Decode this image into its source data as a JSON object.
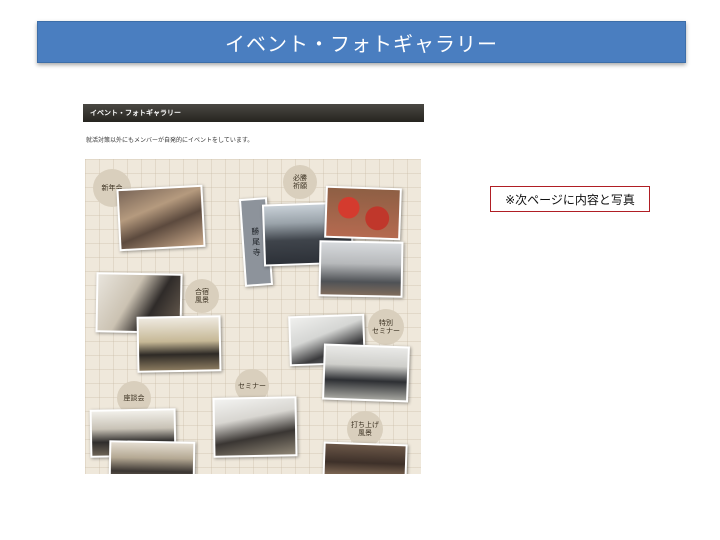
{
  "slide": {
    "title": "イベント・フォトギャラリー"
  },
  "document": {
    "header": "イベント・フォトギャラリー",
    "description": "就活対策以外にもメンバーが自発的にイベントをしています。"
  },
  "gallery": {
    "labels": {
      "new_year": "新年会",
      "victory_prayer": "必勝\n祈願",
      "camp": "合宿\n風景",
      "special_seminar": "特別\nセミナー",
      "roundtable": "座談会",
      "seminar": "セミナー",
      "after_party": "打ち上げ\n風景"
    },
    "sign_text": "勝 尾 寺"
  },
  "note": {
    "text": "※次ページに内容と写真"
  },
  "colors": {
    "title_bar": "#4a7ec0",
    "note_border": "#b01e24",
    "collage_bg": "#efe8db"
  }
}
